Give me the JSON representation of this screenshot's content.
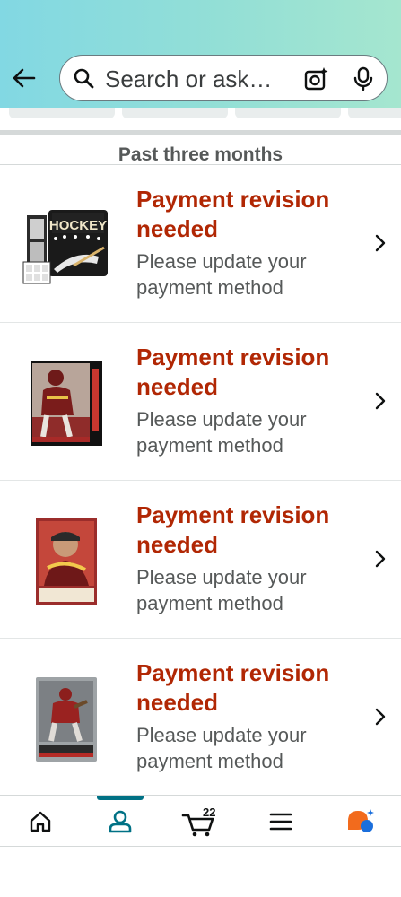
{
  "header": {
    "search_placeholder": "Search or ask…"
  },
  "orders": {
    "section_title": "Past three months",
    "items": [
      {
        "status": "Payment revision needed",
        "message": "Please update your payment method",
        "product_icon": "hockey-card-binder"
      },
      {
        "status": "Payment revision needed",
        "message": "Please update your payment method",
        "product_icon": "football-trading-card"
      },
      {
        "status": "Payment revision needed",
        "message": "Please update your payment method",
        "product_icon": "football-trading-card"
      },
      {
        "status": "Payment revision needed",
        "message": "Please update your payment method",
        "product_icon": "football-trading-card"
      }
    ]
  },
  "nav": {
    "cart_count": "22",
    "items": [
      "home-icon",
      "account-icon",
      "cart-icon",
      "menu-icon",
      "rufus-assistant-icon"
    ],
    "active": "account-icon"
  },
  "colors": {
    "status_red": "#b12704",
    "active_teal": "#007185",
    "header_gradient_start": "#82d8e3",
    "header_gradient_end": "#a5e6cf"
  }
}
